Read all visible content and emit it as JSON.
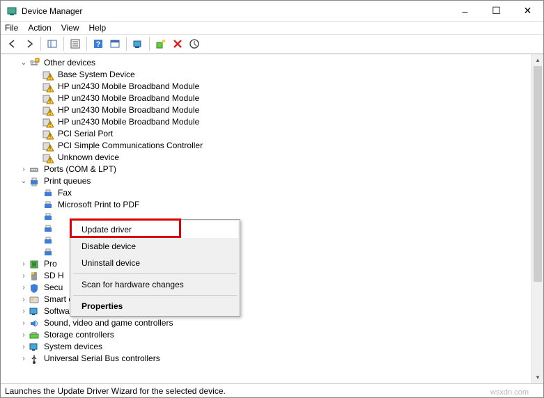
{
  "window": {
    "title": "Device Manager",
    "minimize": "–",
    "maximize": "☐",
    "close": "✕"
  },
  "menu": {
    "file": "File",
    "action": "Action",
    "view": "View",
    "help": "Help"
  },
  "toolbar": {
    "back": "←",
    "forward": "→"
  },
  "tree": {
    "other_devices": "Other devices",
    "base_system": "Base System Device",
    "hp_bb": "HP un2430 Mobile Broadband Module",
    "pci_serial": "PCI Serial Port",
    "pci_comm": "PCI Simple Communications Controller",
    "unknown": "Unknown device",
    "ports": "Ports (COM & LPT)",
    "print_queues": "Print queues",
    "fax": "Fax",
    "ms_pdf": "Microsoft Print to PDF",
    "proc": "Pro",
    "sd": "SD H",
    "secu": "Secu",
    "smart_card": "Smart card readers",
    "software": "Software devices",
    "sound": "Sound, video and game controllers",
    "storage": "Storage controllers",
    "system": "System devices",
    "usb": "Universal Serial Bus controllers"
  },
  "context": {
    "update": "Update driver",
    "disable": "Disable device",
    "uninstall": "Uninstall device",
    "scan": "Scan for hardware changes",
    "properties": "Properties"
  },
  "status": "Launches the Update Driver Wizard for the selected device.",
  "watermark": "wsxdn.com"
}
